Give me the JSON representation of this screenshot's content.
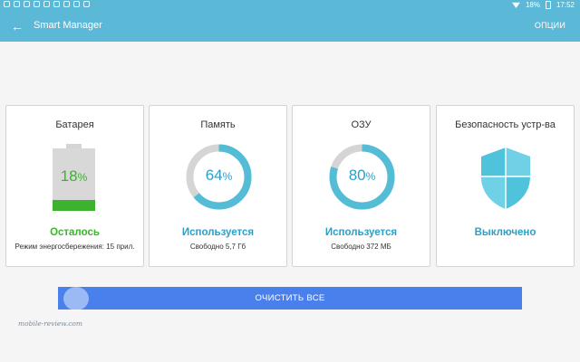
{
  "status_bar": {
    "battery": "18%",
    "time": "17:52"
  },
  "app_bar": {
    "title": "Smart Manager",
    "options_label": "ОПЦИИ"
  },
  "cards": {
    "battery": {
      "title": "Батарея",
      "percent": "18",
      "percent_sign": "%",
      "level": 0.18,
      "status": "Осталось",
      "sub": "Режим энергосбережения: 15 прил."
    },
    "storage": {
      "title": "Память",
      "percent": "64",
      "percent_sign": "%",
      "used_fraction": 0.64,
      "status": "Используется",
      "sub": "Свободно 5,7 Гб"
    },
    "ram": {
      "title": "ОЗУ",
      "percent": "80",
      "percent_sign": "%",
      "used_fraction": 0.8,
      "status": "Используется",
      "sub": "Свободно 372 МБ"
    },
    "security": {
      "title": "Безопасность устр-ва",
      "status": "Выключено"
    }
  },
  "clean_button": {
    "label": "ОЧИСТИТЬ ВСЕ"
  },
  "watermark": {
    "text": "mobile-review.com"
  },
  "colors": {
    "accent": "#5bb8d7",
    "green": "#3bb32e",
    "blue": "#2c9fc7",
    "button": "#4a80ec",
    "track": "#d5d5d5"
  },
  "icons": {
    "back": "arrow-left-icon",
    "wifi": "wifi-icon",
    "battery": "battery-icon",
    "shield": "shield-icon"
  }
}
